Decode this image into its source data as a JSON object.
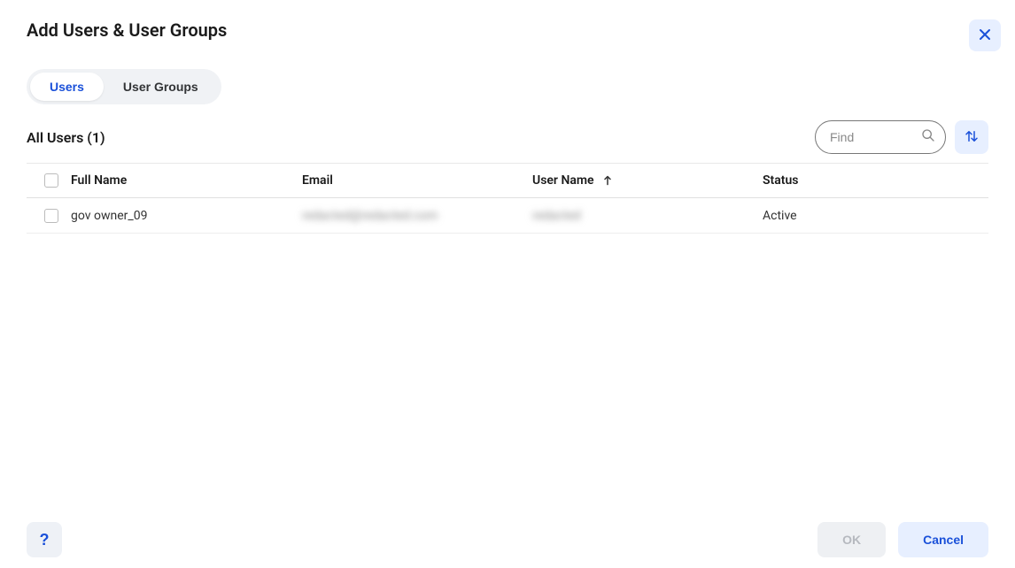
{
  "dialog": {
    "title": "Add Users & User Groups"
  },
  "tabs": {
    "users": "Users",
    "user_groups": "User Groups"
  },
  "list": {
    "heading": "All Users (1)"
  },
  "search": {
    "placeholder": "Find"
  },
  "table": {
    "headers": {
      "full_name": "Full Name",
      "email": "Email",
      "user_name": "User Name",
      "status": "Status"
    },
    "rows": [
      {
        "full_name": "gov owner_09",
        "email": "redacted@redacted.com",
        "user_name": "redacted",
        "status": "Active"
      }
    ]
  },
  "footer": {
    "help": "?",
    "ok": "OK",
    "cancel": "Cancel"
  }
}
